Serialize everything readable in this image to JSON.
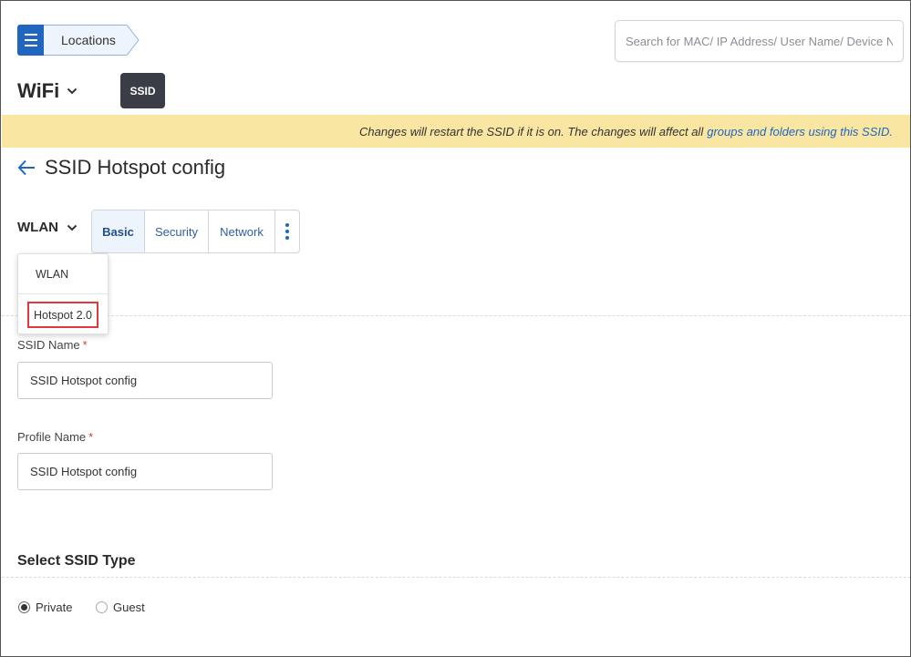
{
  "breadcrumb": {
    "location": "Locations"
  },
  "search": {
    "placeholder": "Search for MAC/ IP Address/ User Name/ Device Name..."
  },
  "header": {
    "product": "WiFi",
    "badge": "SSID"
  },
  "banner": {
    "text": "Changes will restart the SSID if it is on. The changes will affect all",
    "link": "groups and folders using this SSID."
  },
  "page": {
    "title": "SSID Hotspot config"
  },
  "wlan_selector": {
    "label": "WLAN",
    "options": [
      {
        "label": "WLAN"
      },
      {
        "label": "Hotspot 2.0"
      }
    ]
  },
  "tabs": [
    {
      "label": "Basic"
    },
    {
      "label": "Security"
    },
    {
      "label": "Network"
    }
  ],
  "form": {
    "ssid_name": {
      "label": "SSID Name",
      "required_mark": "*",
      "value": "SSID Hotspot config"
    },
    "profile_name": {
      "label": "Profile Name",
      "required_mark": "*",
      "value": "SSID Hotspot config"
    }
  },
  "ssid_type": {
    "title": "Select SSID Type",
    "options": [
      {
        "label": "Private",
        "selected": true
      },
      {
        "label": "Guest",
        "selected": false
      }
    ]
  },
  "colors": {
    "accent": "#1f66c1",
    "banner_bg": "#f9e6a2",
    "badge_bg": "#3a3d45",
    "highlight_border": "#e0383e"
  },
  "icons": {
    "menu": "hamburger-icon",
    "back": "arrow-left-icon",
    "chevron": "chevron-down-icon",
    "more": "kebab-vertical-icon"
  }
}
